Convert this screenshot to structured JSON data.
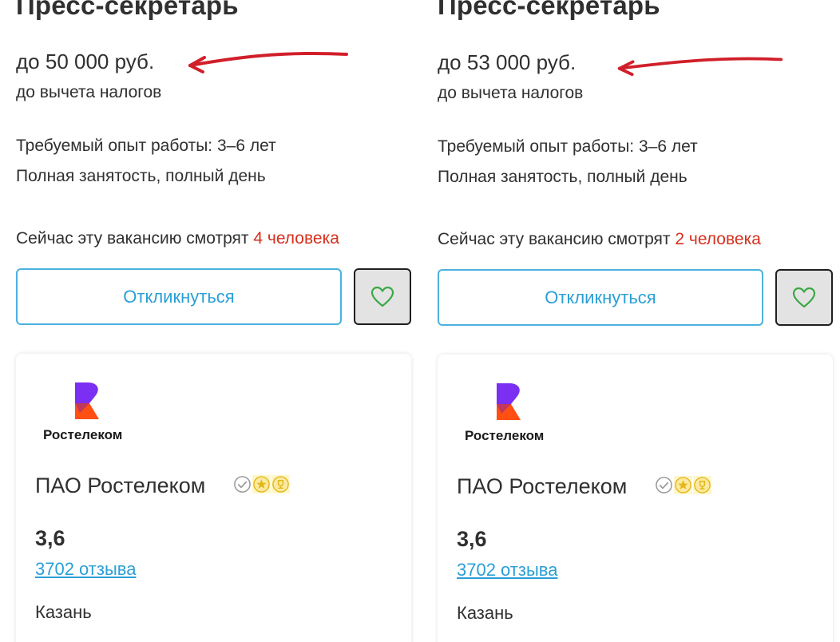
{
  "vacancies": [
    {
      "title": "Пресс-секретарь",
      "salary": "до 50 000 руб.",
      "salary_note": "до вычета налогов",
      "experience": "Требуемый опыт работы: 3–6 лет",
      "employment": "Полная занятость, полный день",
      "viewers_prefix": "Сейчас эту вакансию смотрят ",
      "viewers_count": "4 человека",
      "respond_label": "Откликнуться",
      "favorite_icon": "heart-icon",
      "company": {
        "logo_text": "Ростелеком",
        "name": "ПАО Ростелеком",
        "badges": [
          "verified-check-icon",
          "star-badge-icon",
          "trophy-badge-icon"
        ],
        "rating": "3,6",
        "reviews": "3702 отзыва",
        "city": "Казань"
      }
    },
    {
      "title": "Пресс-секретарь",
      "salary": "до 53 000 руб.",
      "salary_note": "до вычета налогов",
      "experience": "Требуемый опыт работы: 3–6 лет",
      "employment": "Полная занятость, полный день",
      "viewers_prefix": "Сейчас эту вакансию смотрят ",
      "viewers_count": "2 человека",
      "respond_label": "Откликнуться",
      "favorite_icon": "heart-icon",
      "company": {
        "logo_text": "Ростелеком",
        "name": "ПАО Ростелеком",
        "badges": [
          "verified-check-icon",
          "star-badge-icon",
          "trophy-badge-icon"
        ],
        "rating": "3,6",
        "reviews": "3702 отзыва",
        "city": "Казань"
      }
    }
  ],
  "colors": {
    "text": "#303030",
    "accent_blue": "#2a9fd6",
    "button_border": "#4bb2e0",
    "viewers_red": "#d6301e",
    "annotation_red": "#d11f2a",
    "heart_green": "#3aa845",
    "logo_purple": "#7b2ff2",
    "logo_orange": "#ff4f12"
  },
  "annotations": [
    "hand-drawn-arrow"
  ]
}
